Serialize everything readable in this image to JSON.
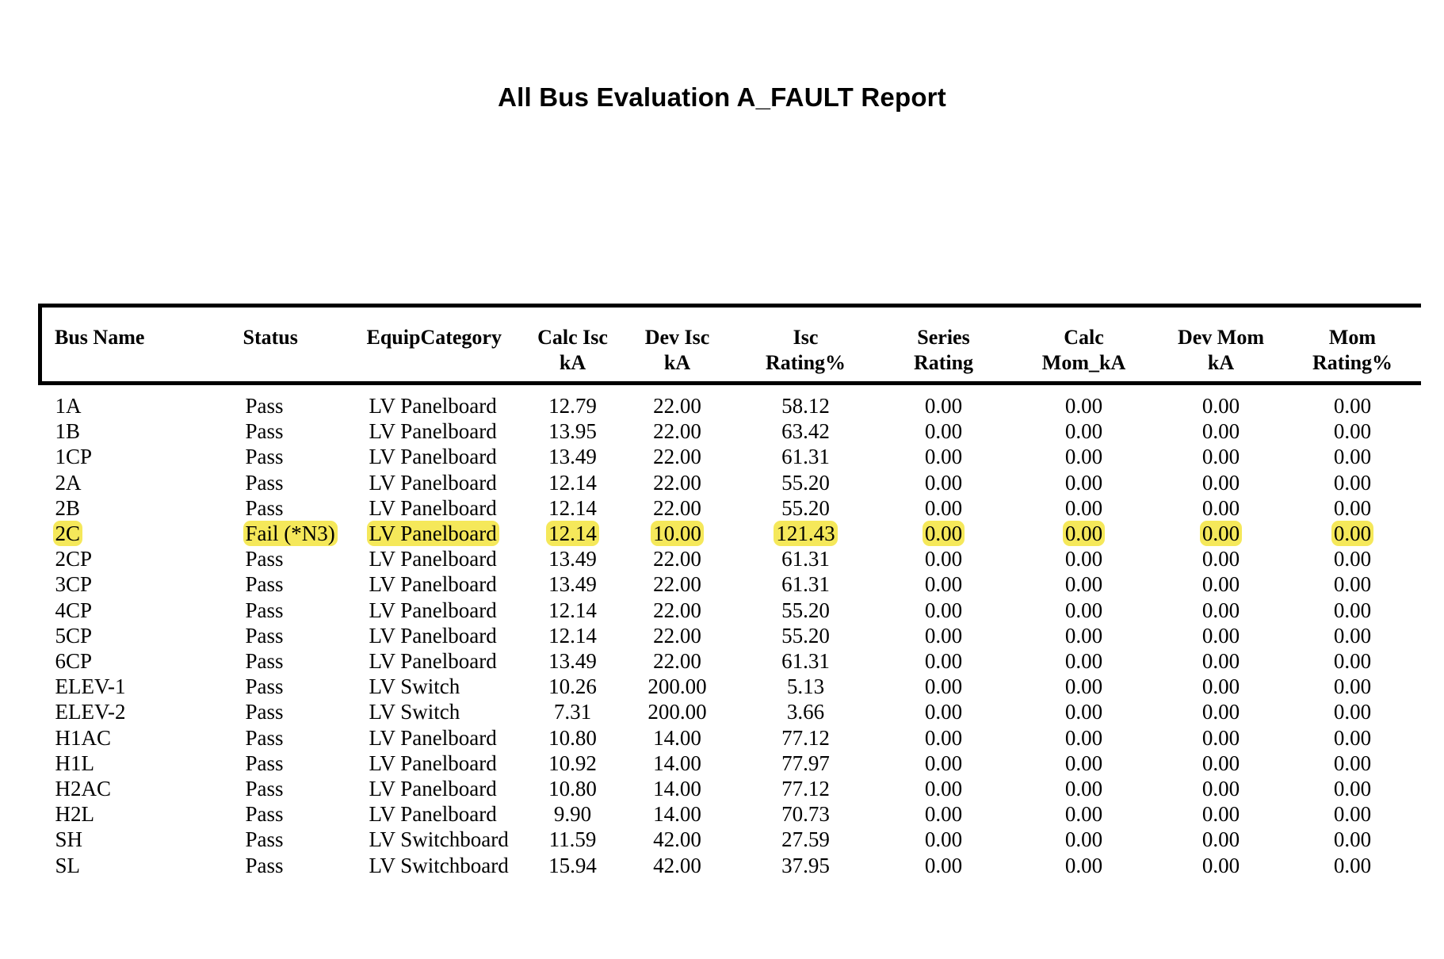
{
  "report": {
    "title": "All Bus Evaluation A_FAULT Report",
    "highlight_color": "#f5e85a",
    "columns": [
      {
        "key": "bus_name",
        "line1": "Bus Name",
        "line2": ""
      },
      {
        "key": "status",
        "line1": "Status",
        "line2": ""
      },
      {
        "key": "equip",
        "line1": "EquipCategory",
        "line2": ""
      },
      {
        "key": "calc_isc",
        "line1": "Calc Isc",
        "line2": "kA"
      },
      {
        "key": "dev_isc",
        "line1": "Dev Isc",
        "line2": "kA"
      },
      {
        "key": "isc_rating",
        "line1": "Isc",
        "line2": "Rating%"
      },
      {
        "key": "series",
        "line1": "Series",
        "line2": "Rating"
      },
      {
        "key": "calc_mom",
        "line1": "Calc",
        "line2": "Mom_kA"
      },
      {
        "key": "dev_mom",
        "line1": "Dev Mom",
        "line2": "kA"
      },
      {
        "key": "mom_rating",
        "line1": "Mom",
        "line2": "Rating%"
      }
    ],
    "rows": [
      {
        "bus_name": "1A",
        "status": "Pass",
        "equip": "LV Panelboard",
        "calc_isc": "12.79",
        "dev_isc": "22.00",
        "isc_rating": "58.12",
        "series": "0.00",
        "calc_mom": "0.00",
        "dev_mom": "0.00",
        "mom_rating": "0.00",
        "highlight": false
      },
      {
        "bus_name": "1B",
        "status": "Pass",
        "equip": "LV Panelboard",
        "calc_isc": "13.95",
        "dev_isc": "22.00",
        "isc_rating": "63.42",
        "series": "0.00",
        "calc_mom": "0.00",
        "dev_mom": "0.00",
        "mom_rating": "0.00",
        "highlight": false
      },
      {
        "bus_name": "1CP",
        "status": "Pass",
        "equip": "LV Panelboard",
        "calc_isc": "13.49",
        "dev_isc": "22.00",
        "isc_rating": "61.31",
        "series": "0.00",
        "calc_mom": "0.00",
        "dev_mom": "0.00",
        "mom_rating": "0.00",
        "highlight": false
      },
      {
        "bus_name": "2A",
        "status": "Pass",
        "equip": "LV Panelboard",
        "calc_isc": "12.14",
        "dev_isc": "22.00",
        "isc_rating": "55.20",
        "series": "0.00",
        "calc_mom": "0.00",
        "dev_mom": "0.00",
        "mom_rating": "0.00",
        "highlight": false
      },
      {
        "bus_name": "2B",
        "status": "Pass",
        "equip": "LV Panelboard",
        "calc_isc": "12.14",
        "dev_isc": "22.00",
        "isc_rating": "55.20",
        "series": "0.00",
        "calc_mom": "0.00",
        "dev_mom": "0.00",
        "mom_rating": "0.00",
        "highlight": false
      },
      {
        "bus_name": "2C",
        "status": "Fail (*N3)",
        "equip": "LV Panelboard",
        "calc_isc": "12.14",
        "dev_isc": "10.00",
        "isc_rating": "121.43",
        "series": "0.00",
        "calc_mom": "0.00",
        "dev_mom": "0.00",
        "mom_rating": "0.00",
        "highlight": true
      },
      {
        "bus_name": "2CP",
        "status": "Pass",
        "equip": "LV Panelboard",
        "calc_isc": "13.49",
        "dev_isc": "22.00",
        "isc_rating": "61.31",
        "series": "0.00",
        "calc_mom": "0.00",
        "dev_mom": "0.00",
        "mom_rating": "0.00",
        "highlight": false
      },
      {
        "bus_name": "3CP",
        "status": "Pass",
        "equip": "LV Panelboard",
        "calc_isc": "13.49",
        "dev_isc": "22.00",
        "isc_rating": "61.31",
        "series": "0.00",
        "calc_mom": "0.00",
        "dev_mom": "0.00",
        "mom_rating": "0.00",
        "highlight": false
      },
      {
        "bus_name": "4CP",
        "status": "Pass",
        "equip": "LV Panelboard",
        "calc_isc": "12.14",
        "dev_isc": "22.00",
        "isc_rating": "55.20",
        "series": "0.00",
        "calc_mom": "0.00",
        "dev_mom": "0.00",
        "mom_rating": "0.00",
        "highlight": false
      },
      {
        "bus_name": "5CP",
        "status": "Pass",
        "equip": "LV Panelboard",
        "calc_isc": "12.14",
        "dev_isc": "22.00",
        "isc_rating": "55.20",
        "series": "0.00",
        "calc_mom": "0.00",
        "dev_mom": "0.00",
        "mom_rating": "0.00",
        "highlight": false
      },
      {
        "bus_name": "6CP",
        "status": "Pass",
        "equip": "LV Panelboard",
        "calc_isc": "13.49",
        "dev_isc": "22.00",
        "isc_rating": "61.31",
        "series": "0.00",
        "calc_mom": "0.00",
        "dev_mom": "0.00",
        "mom_rating": "0.00",
        "highlight": false
      },
      {
        "bus_name": "ELEV-1",
        "status": "Pass",
        "equip": "LV Switch",
        "calc_isc": "10.26",
        "dev_isc": "200.00",
        "isc_rating": "5.13",
        "series": "0.00",
        "calc_mom": "0.00",
        "dev_mom": "0.00",
        "mom_rating": "0.00",
        "highlight": false
      },
      {
        "bus_name": "ELEV-2",
        "status": "Pass",
        "equip": "LV Switch",
        "calc_isc": "7.31",
        "dev_isc": "200.00",
        "isc_rating": "3.66",
        "series": "0.00",
        "calc_mom": "0.00",
        "dev_mom": "0.00",
        "mom_rating": "0.00",
        "highlight": false
      },
      {
        "bus_name": "H1AC",
        "status": "Pass",
        "equip": "LV Panelboard",
        "calc_isc": "10.80",
        "dev_isc": "14.00",
        "isc_rating": "77.12",
        "series": "0.00",
        "calc_mom": "0.00",
        "dev_mom": "0.00",
        "mom_rating": "0.00",
        "highlight": false
      },
      {
        "bus_name": "H1L",
        "status": "Pass",
        "equip": "LV Panelboard",
        "calc_isc": "10.92",
        "dev_isc": "14.00",
        "isc_rating": "77.97",
        "series": "0.00",
        "calc_mom": "0.00",
        "dev_mom": "0.00",
        "mom_rating": "0.00",
        "highlight": false
      },
      {
        "bus_name": "H2AC",
        "status": "Pass",
        "equip": "LV Panelboard",
        "calc_isc": "10.80",
        "dev_isc": "14.00",
        "isc_rating": "77.12",
        "series": "0.00",
        "calc_mom": "0.00",
        "dev_mom": "0.00",
        "mom_rating": "0.00",
        "highlight": false
      },
      {
        "bus_name": "H2L",
        "status": "Pass",
        "equip": "LV Panelboard",
        "calc_isc": "9.90",
        "dev_isc": "14.00",
        "isc_rating": "70.73",
        "series": "0.00",
        "calc_mom": "0.00",
        "dev_mom": "0.00",
        "mom_rating": "0.00",
        "highlight": false
      },
      {
        "bus_name": "SH",
        "status": "Pass",
        "equip": "LV Switchboard",
        "calc_isc": "11.59",
        "dev_isc": "42.00",
        "isc_rating": "27.59",
        "series": "0.00",
        "calc_mom": "0.00",
        "dev_mom": "0.00",
        "mom_rating": "0.00",
        "highlight": false
      },
      {
        "bus_name": "SL",
        "status": "Pass",
        "equip": "LV Switchboard",
        "calc_isc": "15.94",
        "dev_isc": "42.00",
        "isc_rating": "37.95",
        "series": "0.00",
        "calc_mom": "0.00",
        "dev_mom": "0.00",
        "mom_rating": "0.00",
        "highlight": false
      }
    ]
  }
}
